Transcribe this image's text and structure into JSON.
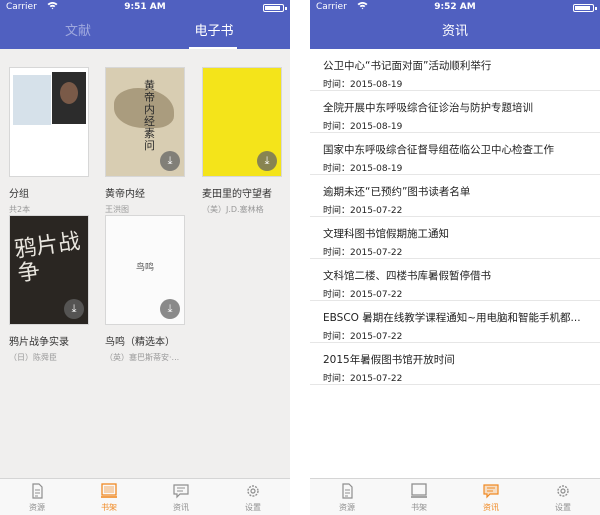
{
  "left": {
    "status": {
      "carrier": "Carrier",
      "time": "9:51 AM"
    },
    "tabs": {
      "literature": "文献",
      "ebooks": "电子书"
    },
    "books": [
      {
        "title": "分组",
        "author": "共2本"
      },
      {
        "title": "黄帝内经",
        "author": "王洪图",
        "cover_text": "黄帝内经素问"
      },
      {
        "title": "麦田里的守望者",
        "author": "（美）J.D.塞林格"
      },
      {
        "title": "鸦片战争实录",
        "author": "（日）陈舜臣",
        "cover_text": "鸦片战争"
      },
      {
        "title": "鸟鸣（精选本）",
        "author": "（英）塞巴斯蒂安·...",
        "cover_text": "鸟鸣"
      }
    ],
    "tabbar": [
      {
        "label": "资源",
        "icon": "document-icon",
        "active": false
      },
      {
        "label": "书架",
        "icon": "bookshelf-icon",
        "active": true
      },
      {
        "label": "资讯",
        "icon": "message-icon",
        "active": false
      },
      {
        "label": "设置",
        "icon": "gear-icon",
        "active": false
      }
    ]
  },
  "right": {
    "status": {
      "carrier": "Carrier",
      "time": "9:52 AM"
    },
    "title": "资讯",
    "time_label": "时间：",
    "news": [
      {
        "title": "公卫中心“书记面对面”活动顺利举行",
        "date": "2015-08-19"
      },
      {
        "title": "全院开展中东呼吸综合征诊治与防护专题培训",
        "date": "2015-08-19"
      },
      {
        "title": "国家中东呼吸综合征督导组莅临公卫中心检查工作",
        "date": "2015-08-19"
      },
      {
        "title": "逾期未还“已预约”图书读者名单",
        "date": "2015-07-22"
      },
      {
        "title": "文理科图书馆假期施工通知",
        "date": "2015-07-22"
      },
      {
        "title": "文科馆二楼、四楼书库暑假暂停借书",
        "date": "2015-07-22"
      },
      {
        "title": "EBSCO 暑期在线教学课程通知~用电脑和智能手机都...",
        "date": "2015-07-22"
      },
      {
        "title": "2015年暑假图书馆开放时间",
        "date": "2015-07-22"
      }
    ],
    "tabbar": [
      {
        "label": "资源",
        "icon": "document-icon",
        "active": false
      },
      {
        "label": "书架",
        "icon": "bookshelf-icon",
        "active": false
      },
      {
        "label": "资讯",
        "icon": "message-icon",
        "active": true
      },
      {
        "label": "设置",
        "icon": "gear-icon",
        "active": false
      }
    ]
  },
  "colors": {
    "nav": "#5060c0",
    "accent": "#f08a24",
    "inactive": "#8f8f8f"
  }
}
